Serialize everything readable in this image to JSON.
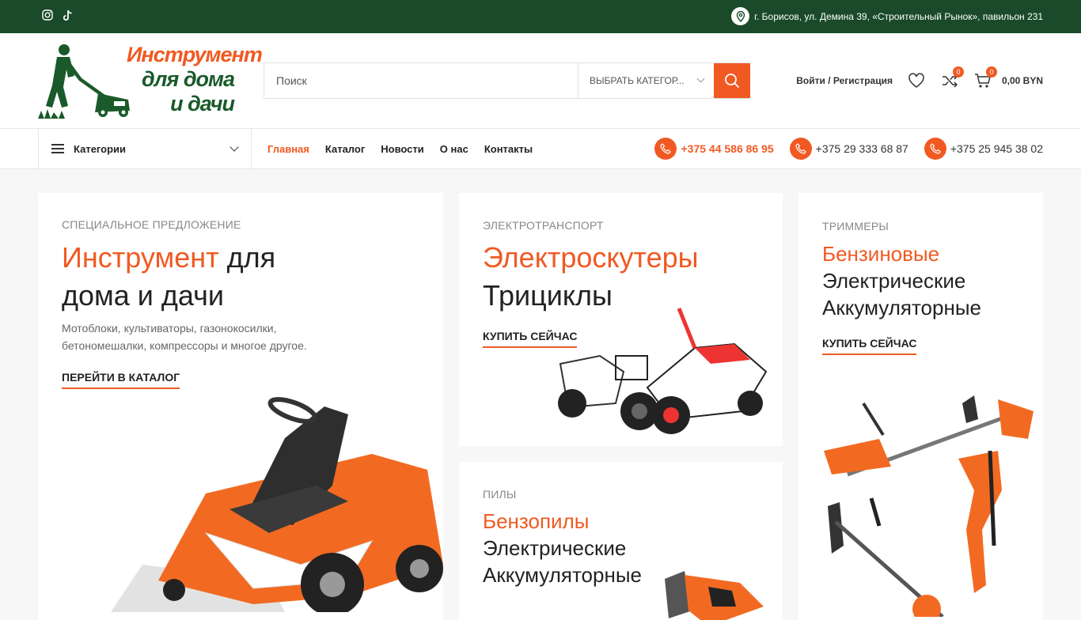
{
  "topbar": {
    "social": [
      {
        "icon": "instagram-icon"
      },
      {
        "icon": "tiktok-icon"
      }
    ],
    "address": "г. Борисов, ул. Демина 39, «Строительный Рынок», павильон 231"
  },
  "logo": {
    "line1": "Инструмент",
    "line2": "для дома",
    "line3": "и дачи"
  },
  "search": {
    "placeholder": "Поиск",
    "category": "ВЫБРАТЬ КАТЕГОР..."
  },
  "header": {
    "login": "Войти / Регистрация",
    "compare_count": "0",
    "cart_count": "0",
    "cart_total": "0,00 BYN"
  },
  "nav": {
    "categories_label": "Категории",
    "menu": [
      "Главная",
      "Каталог",
      "Новости",
      "О нас",
      "Контакты"
    ],
    "phones": [
      "+375 44 586 86 95",
      "+375 29 333 68 87",
      "+375 25 945 38 02"
    ]
  },
  "banners": {
    "b1": {
      "kicker": "СПЕЦИАЛЬНОЕ ПРЕДЛОЖЕНИЕ",
      "title_accent": "Инструмент",
      "title_rest1": " для",
      "title_rest2": "дома и дачи",
      "desc": "Мотоблоки, культиваторы, газонокосилки, бетономешалки, компрессоры и многое другое.",
      "cta": "ПЕРЕЙТИ В КАТАЛОГ"
    },
    "b2": {
      "kicker": "ЭЛЕКТРОТРАНСПОРТ",
      "title_accent": "Электроскутеры",
      "title_rest": "Трициклы",
      "cta": "КУПИТЬ СЕЙЧАС"
    },
    "b3": {
      "kicker": "ПИЛЫ",
      "title_accent": "Бензопилы",
      "line2": "Электрические",
      "line3": "Аккумуляторные"
    },
    "b4": {
      "kicker": "ТРИММЕРЫ",
      "title_accent": "Бензиновые",
      "line2": "Электрические",
      "line3": "Аккумуляторные",
      "cta": "КУПИТЬ СЕЙЧАС"
    }
  },
  "colors": {
    "accent": "#f05a22",
    "topbar": "#1a4a2a"
  }
}
